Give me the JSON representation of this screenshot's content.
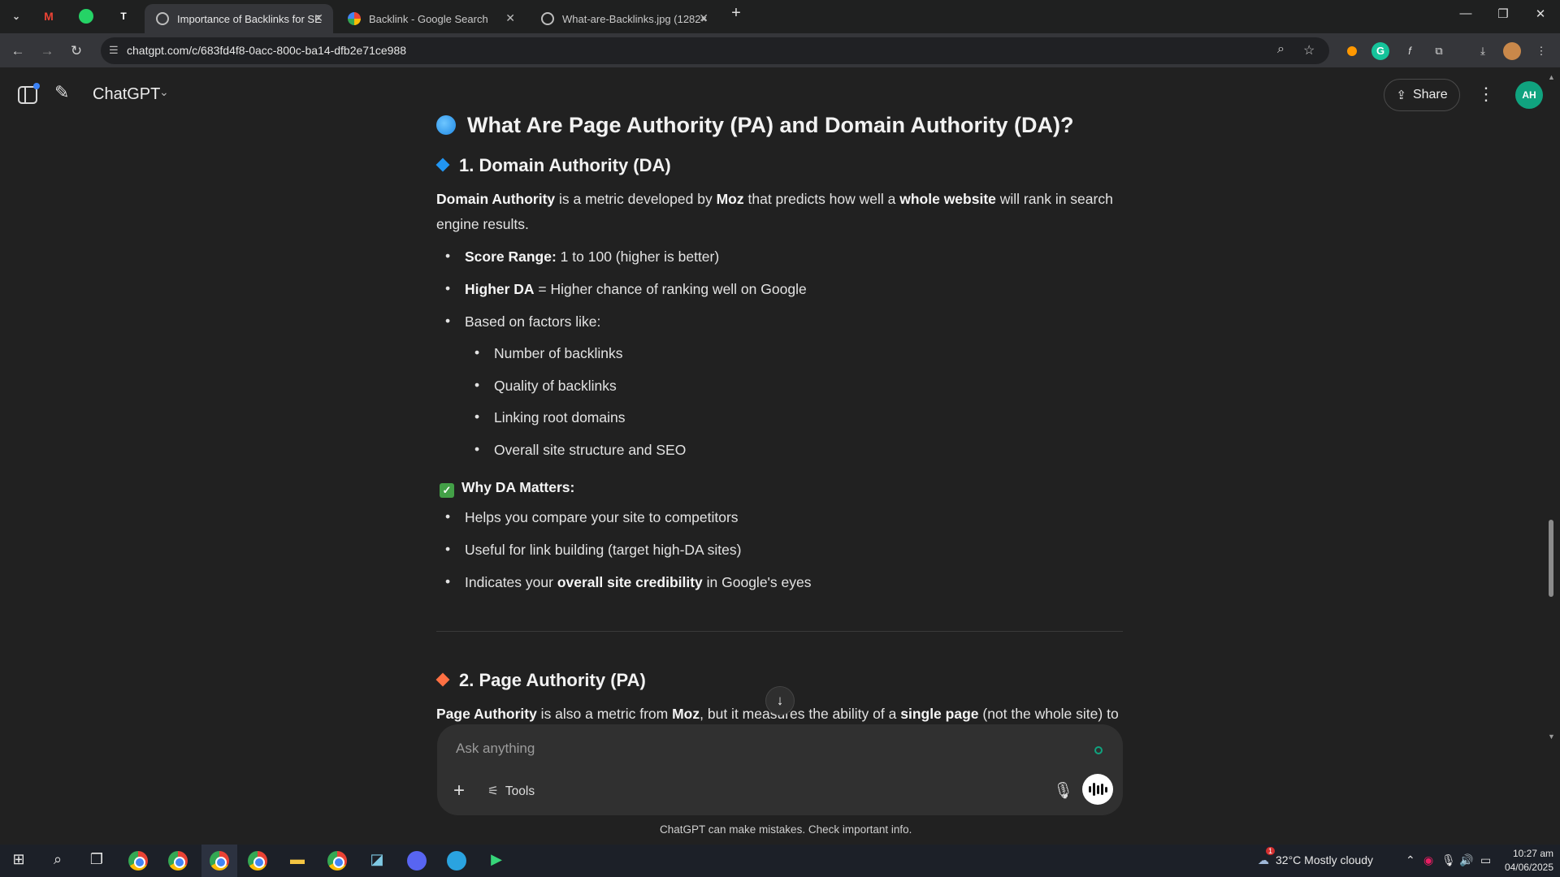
{
  "browser": {
    "tabs": [
      {
        "title": "Importance of Backlinks for SE",
        "active": true
      },
      {
        "title": "Backlink - Google Search",
        "active": false
      },
      {
        "title": "What-are-Backlinks.jpg (1282×",
        "active": false
      }
    ],
    "url": "chatgpt.com/c/683fd4f8-0acc-800c-ba14-dfb2e71ce988"
  },
  "header": {
    "app_title": "ChatGPT",
    "share_label": "Share",
    "avatar_initials": "AH"
  },
  "article": {
    "title": "What Are Page Authority (PA) and Domain Authority (DA)?",
    "da": {
      "heading": "1. Domain Authority (DA)",
      "intro": {
        "b1": "Domain Authority",
        "t1": " is a metric developed by ",
        "b2": "Moz",
        "t2": " that predicts how well a ",
        "b3": "whole website",
        "t3": " will rank in search engine results."
      },
      "bullets": [
        {
          "bold": "Score Range:",
          "text": " 1 to 100 (higher is better)"
        },
        {
          "bold": "Higher DA",
          "text": " = Higher chance of ranking well on Google"
        },
        {
          "bold": "",
          "text": "Based on factors like:"
        }
      ],
      "factors": [
        "Number of backlinks",
        "Quality of backlinks",
        "Linking root domains",
        "Overall site structure and SEO"
      ],
      "why_heading": "Why DA Matters:",
      "why": [
        {
          "pre": "Helps you compare your site to competitors",
          "bold": "",
          "post": ""
        },
        {
          "pre": "Useful for link building (target high-DA sites)",
          "bold": "",
          "post": ""
        },
        {
          "pre": "Indicates your ",
          "bold": "overall site credibility",
          "post": " in Google's eyes"
        }
      ]
    },
    "pa": {
      "heading": "2. Page Authority (PA)",
      "intro": {
        "b1": "Page Authority",
        "t1": " is also a metric from ",
        "b2": "Moz",
        "t2": ", but it measures the ability of a ",
        "b3": "single page",
        "t3": " (not the whole site) to"
      }
    }
  },
  "composer": {
    "placeholder": "Ask anything",
    "tools_label": "Tools"
  },
  "disclaimer": "ChatGPT can make mistakes. Check important info.",
  "taskbar": {
    "weather": "32°C  Mostly cloudy",
    "time": "10:27 am",
    "date": "04/06/2025",
    "notification_count": "1"
  }
}
